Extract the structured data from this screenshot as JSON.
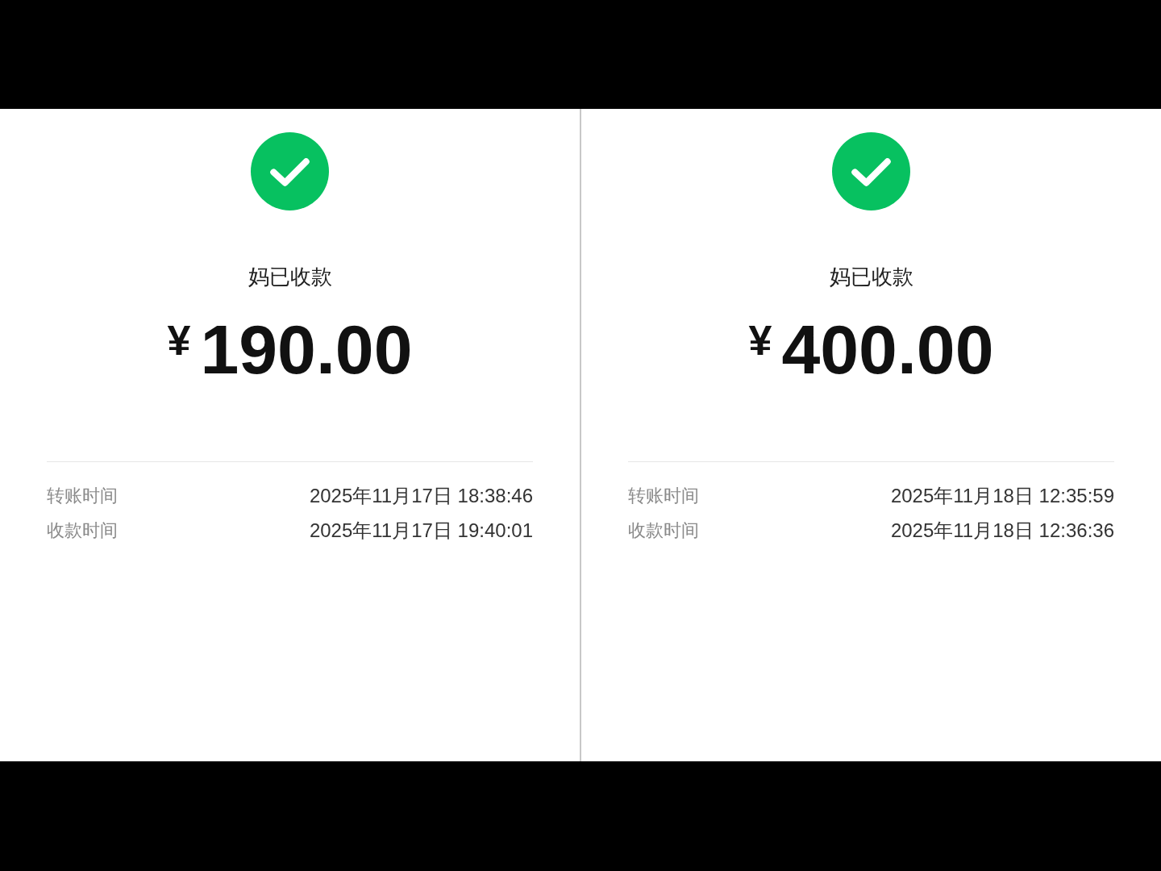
{
  "receipts": [
    {
      "status": "妈已收款",
      "currency": "¥",
      "amount": "190.00",
      "details": [
        {
          "label": "转账时间",
          "value": "2025年11月17日 18:38:46"
        },
        {
          "label": "收款时间",
          "value": "2025年11月17日 19:40:01"
        }
      ]
    },
    {
      "status": "妈已收款",
      "currency": "¥",
      "amount": "400.00",
      "details": [
        {
          "label": "转账时间",
          "value": "2025年11月18日 12:35:59"
        },
        {
          "label": "收款时间",
          "value": "2025年11月18日 12:36:36"
        }
      ]
    }
  ]
}
